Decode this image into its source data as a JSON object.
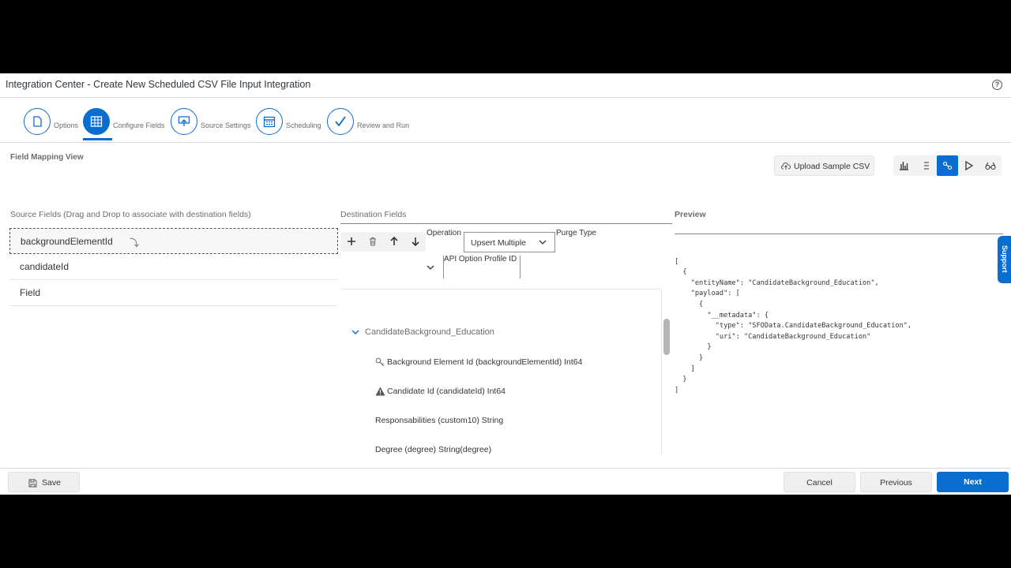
{
  "app": {
    "title": "Integration Center - Create New Scheduled CSV File Input Integration",
    "help_icon": "?"
  },
  "steps": [
    {
      "label": "Options",
      "icon": "document-icon"
    },
    {
      "label": "Configure Fields",
      "icon": "table-icon"
    },
    {
      "label": "Source Settings",
      "icon": "upload-screen-icon"
    },
    {
      "label": "Scheduling",
      "icon": "calendar-icon"
    },
    {
      "label": "Review and Run",
      "icon": "checkmark-icon"
    }
  ],
  "main": {
    "section_title": "Field Mapping View",
    "upload_label": "Upload Sample CSV",
    "source_header": "Source Fields (Drag and Drop to associate with destination fields)",
    "destination_header": "Destination Fields",
    "preview_header": "Preview",
    "support_label": "Support"
  },
  "source_fields": [
    "backgroundElementId",
    "candidateId",
    "Field"
  ],
  "destination": {
    "operation_label": "Operation",
    "operation_value": "Upsert Multiple",
    "purge_label": "Purge Type",
    "api_label": "API Option Profile ID",
    "entity": "CandidateBackground_Education",
    "fields": [
      {
        "label": "Background Element Id (backgroundElementId) Int64",
        "icon": "key-icon"
      },
      {
        "label": "Candidate Id (candidateId) Int64",
        "icon": "warning-icon"
      },
      {
        "label": "Responsabilities (custom10) String",
        "icon": ""
      },
      {
        "label": "Degree (degree) String(degree)",
        "icon": ""
      }
    ]
  },
  "preview_lines": [
    "[",
    "  {",
    "    \"entityName\": \"CandidateBackground_Education\",",
    "    \"payload\": [",
    "      {",
    "        \"__metadata\": {",
    "          \"type\": \"SFOData.CandidateBackground_Education\",",
    "          \"uri\": \"CandidateBackground_Education\"",
    "        }",
    "      }",
    "    ]",
    "  }",
    "]"
  ],
  "footer": {
    "save": "Save",
    "cancel": "Cancel",
    "previous": "Previous",
    "next": "Next"
  },
  "colors": {
    "accent": "#0a6ed1"
  }
}
